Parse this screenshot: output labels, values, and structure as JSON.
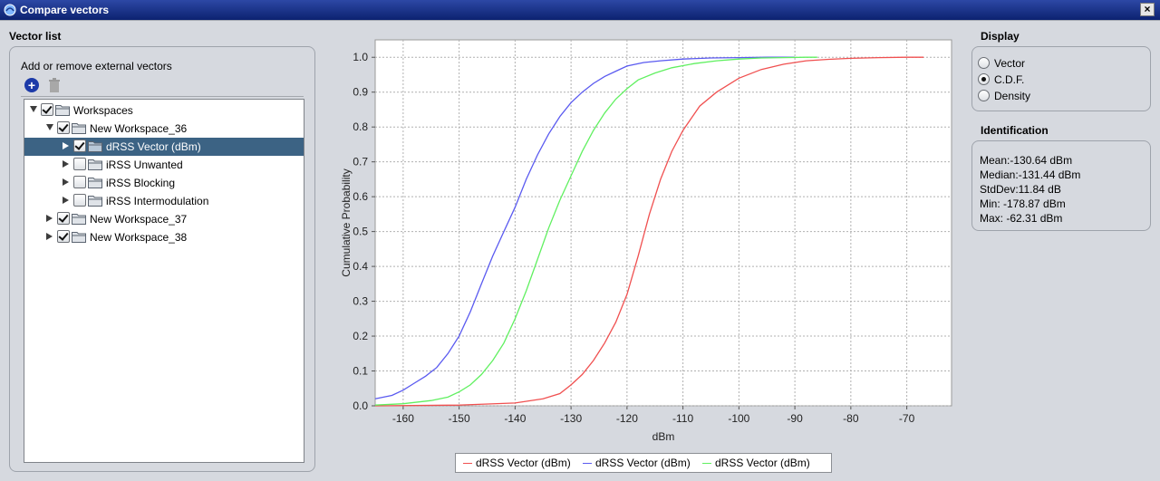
{
  "window": {
    "title": "Compare vectors",
    "close_label": "×"
  },
  "vector_list": {
    "section_title": "Vector list",
    "toolbar_label": "Add or remove external vectors",
    "tree": [
      {
        "label": "Workspaces",
        "level": 0,
        "expanded": true,
        "checked": true,
        "selected": false
      },
      {
        "label": "New Workspace_36",
        "level": 1,
        "expanded": true,
        "checked": true,
        "selected": false
      },
      {
        "label": "dRSS Vector (dBm)",
        "level": 2,
        "expanded": false,
        "checked": true,
        "selected": true
      },
      {
        "label": "iRSS Unwanted",
        "level": 2,
        "expanded": false,
        "checked": false,
        "selected": false
      },
      {
        "label": "iRSS Blocking",
        "level": 2,
        "expanded": false,
        "checked": false,
        "selected": false
      },
      {
        "label": "iRSS Intermodulation",
        "level": 2,
        "expanded": false,
        "checked": false,
        "selected": false
      },
      {
        "label": "New Workspace_37",
        "level": 1,
        "expanded": false,
        "checked": true,
        "selected": false
      },
      {
        "label": "New Workspace_38",
        "level": 1,
        "expanded": false,
        "checked": true,
        "selected": false
      }
    ]
  },
  "display": {
    "section_title": "Display",
    "options": [
      {
        "label": "Vector",
        "selected": false
      },
      {
        "label": "C.D.F.",
        "selected": true
      },
      {
        "label": "Density",
        "selected": false
      }
    ]
  },
  "identification": {
    "section_title": "Identification",
    "lines": [
      "Mean:-130.64 dBm",
      "Median:-131.44 dBm",
      "StdDev:11.84 dB",
      "Min: -178.87 dBm",
      "Max: -62.31 dBm"
    ]
  },
  "chart_data": {
    "type": "line",
    "xlabel": "dBm",
    "ylabel": "Cumulative Probability",
    "xlim": [
      -165,
      -62
    ],
    "ylim": [
      0,
      1.05
    ],
    "x_ticks": [
      -160,
      -150,
      -140,
      -130,
      -120,
      -110,
      -100,
      -90,
      -80,
      -70
    ],
    "y_ticks": [
      0.0,
      0.1,
      0.2,
      0.3,
      0.4,
      0.5,
      0.6,
      0.7,
      0.8,
      0.9,
      1.0
    ],
    "x_tick_labels": [
      "-160",
      "-150",
      "-140",
      "-130",
      "-120",
      "-110",
      "-100",
      "-90",
      "-80",
      "-70"
    ],
    "y_tick_labels": [
      "0.0",
      "0.1",
      "0.2",
      "0.3",
      "0.4",
      "0.5",
      "0.6",
      "0.7",
      "0.8",
      "0.9",
      "1.0"
    ],
    "grid": true,
    "legend_position": "bottom",
    "series": [
      {
        "name": "dRSS Vector (dBm)",
        "color": "#f05050",
        "x": [
          -165,
          -150,
          -140,
          -135,
          -132,
          -130,
          -128,
          -126,
          -124,
          -122,
          -120,
          -118,
          -116,
          -114,
          -112,
          -110,
          -107,
          -104,
          -100,
          -96,
          -92,
          -88,
          -84,
          -80,
          -75,
          -70,
          -67
        ],
        "y": [
          0.0,
          0.002,
          0.008,
          0.02,
          0.035,
          0.06,
          0.09,
          0.13,
          0.18,
          0.24,
          0.32,
          0.43,
          0.55,
          0.65,
          0.73,
          0.79,
          0.86,
          0.9,
          0.94,
          0.965,
          0.98,
          0.99,
          0.994,
          0.997,
          0.999,
          1.0,
          1.0
        ]
      },
      {
        "name": "dRSS Vector (dBm)",
        "color": "#5a5af0",
        "x": [
          -165,
          -162,
          -160,
          -158,
          -156,
          -154,
          -152,
          -150,
          -148,
          -146,
          -144,
          -142,
          -140,
          -138,
          -136,
          -134,
          -132,
          -130,
          -128,
          -126,
          -124,
          -122,
          -120,
          -117,
          -114,
          -110,
          -105,
          -100,
          -95,
          -90
        ],
        "y": [
          0.02,
          0.03,
          0.045,
          0.065,
          0.085,
          0.11,
          0.15,
          0.2,
          0.27,
          0.35,
          0.43,
          0.5,
          0.57,
          0.65,
          0.72,
          0.78,
          0.83,
          0.87,
          0.9,
          0.925,
          0.945,
          0.96,
          0.975,
          0.985,
          0.99,
          0.995,
          0.998,
          0.999,
          1.0,
          1.0
        ]
      },
      {
        "name": "dRSS Vector (dBm)",
        "color": "#60f060",
        "x": [
          -165,
          -160,
          -155,
          -152,
          -150,
          -148,
          -146,
          -144,
          -142,
          -140,
          -138,
          -136,
          -134,
          -132,
          -130,
          -128,
          -126,
          -124,
          -122,
          -120,
          -118,
          -115,
          -112,
          -108,
          -104,
          -100,
          -96,
          -92,
          -88,
          -86
        ],
        "y": [
          0.002,
          0.006,
          0.015,
          0.025,
          0.04,
          0.06,
          0.09,
          0.13,
          0.18,
          0.25,
          0.33,
          0.42,
          0.51,
          0.59,
          0.66,
          0.73,
          0.79,
          0.84,
          0.88,
          0.91,
          0.935,
          0.955,
          0.97,
          0.982,
          0.99,
          0.995,
          0.998,
          0.999,
          1.0,
          1.0
        ]
      }
    ]
  }
}
